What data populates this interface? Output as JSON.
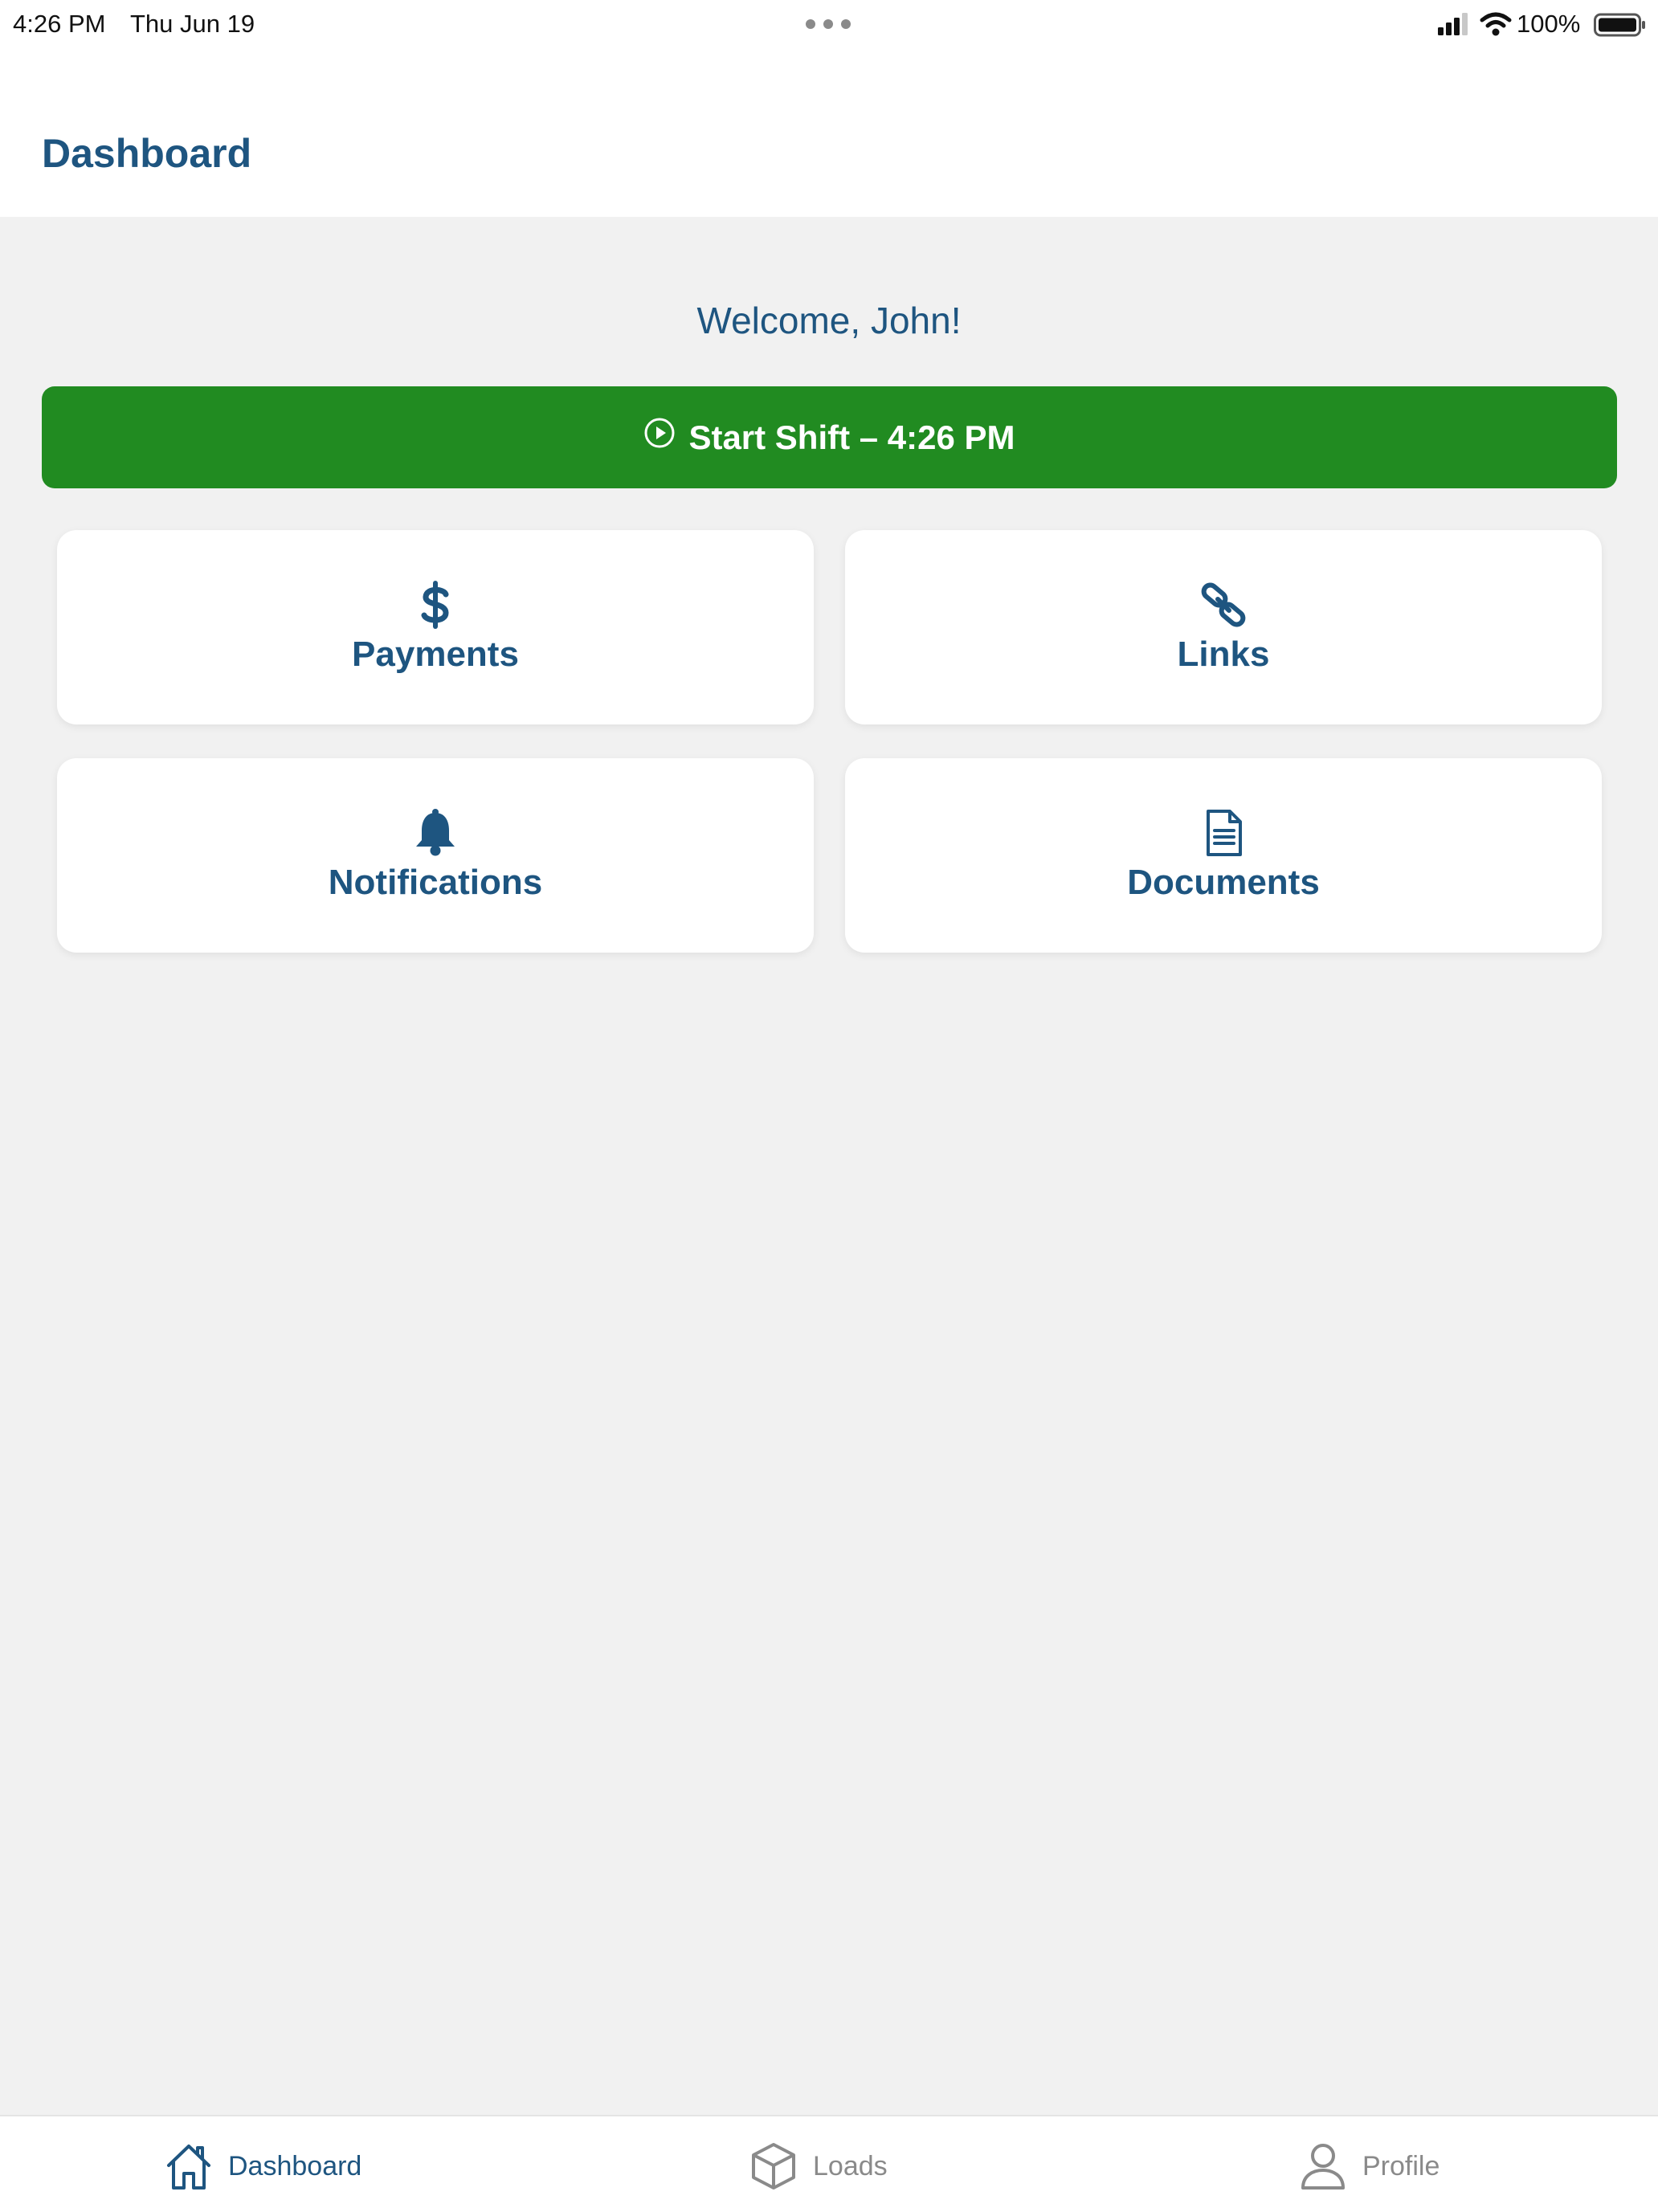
{
  "status_bar": {
    "time": "4:26 PM",
    "date": "Thu Jun 19",
    "battery_percent": "100%",
    "icons": [
      "more-dots-icon",
      "cellular-signal-icon",
      "wifi-icon",
      "battery-icon"
    ]
  },
  "nav": {
    "title": "Dashboard"
  },
  "welcome": "Welcome, John!",
  "shift_button": {
    "label": "Start Shift – 4:26 PM",
    "icon": "play-circle-icon",
    "color": "#218b21"
  },
  "tiles": [
    {
      "label": "Payments",
      "icon": "dollar-icon"
    },
    {
      "label": "Links",
      "icon": "link-icon"
    },
    {
      "label": "Notifications",
      "icon": "bell-icon"
    },
    {
      "label": "Documents",
      "icon": "document-icon"
    }
  ],
  "tab_bar": {
    "tabs": [
      {
        "label": "Dashboard",
        "icon": "home-icon",
        "active": true
      },
      {
        "label": "Loads",
        "icon": "box-icon",
        "active": false
      },
      {
        "label": "Profile",
        "icon": "user-icon",
        "active": false
      }
    ]
  },
  "colors": {
    "primary": "#1e5580",
    "accent_green": "#218b21",
    "background": "#f1f1f1",
    "inactive": "#8a8a8a"
  }
}
